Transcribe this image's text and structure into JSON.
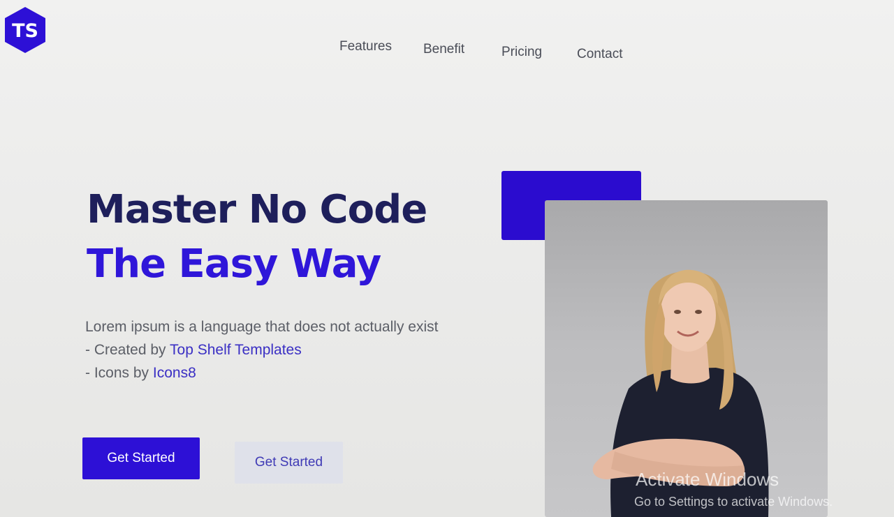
{
  "brand": {
    "logo_text": "TS",
    "logo_color": "#2d10d6"
  },
  "nav": {
    "items": [
      {
        "label": "Features"
      },
      {
        "label": "Benefit"
      },
      {
        "label": "Pricing"
      },
      {
        "label": "Contact"
      }
    ]
  },
  "hero": {
    "title_line1": "Master No Code",
    "title_line2": "The Easy Way",
    "description": "Lorem ipsum is a language that does not actually exist",
    "credit_prefix": "- Created by ",
    "credit_link": "Top Shelf Templates",
    "icons_prefix": "- Icons by ",
    "icons_link": "Icons8",
    "primary_button": "Get Started",
    "secondary_button": "Get Started"
  },
  "colors": {
    "title_dark": "#1e1f5b",
    "accent": "#2f16d9",
    "link": "#3a2fc4"
  },
  "watermark": {
    "line1": "Activate Windows",
    "line2": "Go to Settings to activate Windows."
  }
}
